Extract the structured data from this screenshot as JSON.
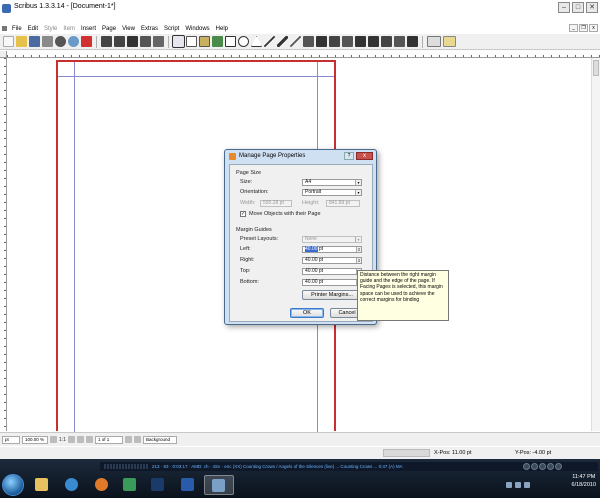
{
  "window": {
    "title": "Scribus 1.3.3.14 - [Document-1*]",
    "controls": {
      "minimize": "–",
      "maximize": "□",
      "close": "✕"
    },
    "mdi_controls": {
      "minimize": "_",
      "restore": "❐",
      "close": "x"
    }
  },
  "menu": [
    "File",
    "Edit",
    "Style",
    "Item",
    "Insert",
    "Page",
    "View",
    "Extras",
    "Script",
    "Windows",
    "Help"
  ],
  "menu_disabled": [
    "Style",
    "Item"
  ],
  "canvas": {
    "page_border_color": "#c83030",
    "margin_color": "#8a8ad0"
  },
  "dialog": {
    "title": "Manage Page Properties",
    "help_label": "?",
    "close_label": "x",
    "page_size": {
      "section": "Page Size",
      "size_label": "Size:",
      "size_value": "A4",
      "orientation_label": "Orientation:",
      "orientation_value": "Portrait",
      "width_label": "Width:",
      "width_value": "595.28 pt",
      "height_label": "Height:",
      "height_value": "841.89 pt",
      "move_objects_label": "Move Objects with their Page",
      "move_objects_checked": true
    },
    "margin_guides": {
      "section": "Margin Guides",
      "preset_label": "Preset Layouts:",
      "preset_value": "None",
      "left_label": "Left:",
      "left_selected": "40.00",
      "left_unit": " pt",
      "right_label": "Right:",
      "right_value": "40.00 pt",
      "top_label": "Top:",
      "top_value": "40.00 pt",
      "bottom_label": "Bottom:",
      "bottom_value": "40.00 pt",
      "printer_margins_label": "Printer Margins..."
    },
    "ok_label": "OK",
    "cancel_label": "Cancel"
  },
  "tooltip": "Distance between the right margin guide and the edge of the page. If Facing Pages is selected, this margin space can be used to achieve the correct margins for binding",
  "statusbar": {
    "unit": "pt",
    "zoom": "100.00 %",
    "zoom_ratio": "1:1",
    "page": "1 of 1",
    "layer": "Background"
  },
  "coords": {
    "x": "X-Pos: 11.00 pt",
    "y": "Y-Pos: -4.00 pt"
  },
  "media_player": {
    "track": "213  ·  83  ·  0:03:17  ·  AMD: ch  ·  4Sv  ·  enc  (XX) Counting Crows / Angels of the Silences (live) ...  Counting Crows ...  0:47  (A)  MA"
  },
  "taskbar": {
    "apps": [
      {
        "name": "explorer-icon",
        "color": "#e8c060"
      },
      {
        "name": "internet-explorer-icon",
        "color": "#3a8ad0"
      },
      {
        "name": "firefox-icon",
        "color": "#e07a2a"
      },
      {
        "name": "scribus-icon",
        "color": "#3a9a5a"
      },
      {
        "name": "photoshop-icon",
        "color": "#1a3a6a"
      },
      {
        "name": "word-icon",
        "color": "#2a5aaa"
      },
      {
        "name": "media-icon",
        "color": "#7aa0c8"
      }
    ],
    "time": "11:47 PM",
    "date": "6/18/2010"
  }
}
